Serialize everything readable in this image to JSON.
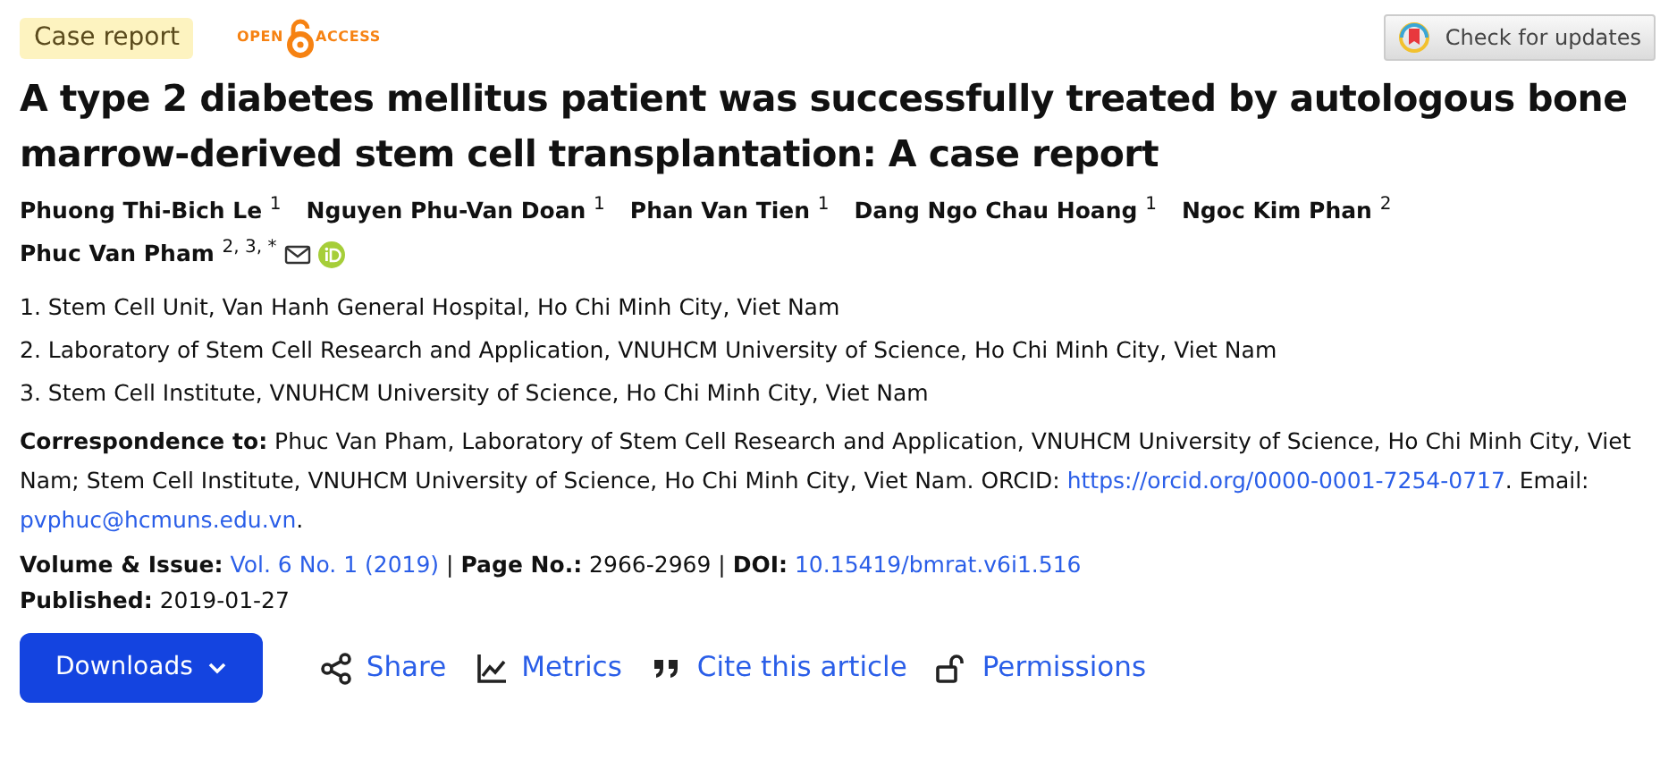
{
  "article_type": "Case report",
  "open_access": {
    "left": "OPEN",
    "right": "ACCESS"
  },
  "check_updates": "Check for updates",
  "title": "A type 2 diabetes mellitus patient was successfully treated by autologous bone marrow-derived stem cell transplantation: A case report",
  "authors": [
    {
      "name": "Phuong Thi-Bich Le $^{1}$",
      "contact": false
    },
    {
      "name": "Nguyen Phu-Van Doan $^{1}$",
      "contact": false
    },
    {
      "name": "Phan Van Tien $^{1}$",
      "contact": false
    },
    {
      "name": "Dang Ngo Chau Hoang $^{1}$",
      "contact": false
    },
    {
      "name": "Ngoc Kim Phan $^{2}$",
      "contact": false
    },
    {
      "name": "Phuc Van Pham $^{2, 3, *}$",
      "contact": true
    }
  ],
  "affiliations": [
    "1. Stem Cell Unit, Van Hanh General Hospital, Ho Chi Minh City, Viet Nam",
    "2. Laboratory of Stem Cell Research and Application, VNUHCM University of Science, Ho Chi Minh City, Viet Nam",
    "3. Stem Cell Institute, VNUHCM University of Science, Ho Chi Minh City, Viet Nam"
  ],
  "correspondence": [
    {
      "kind": "bold",
      "text": "Correspondence to:"
    },
    {
      "kind": "text",
      "text": " Phuc Van Pham, Laboratory of Stem Cell Research and Application, VNUHCM University of Science, Ho Chi Minh City, Viet Nam; Stem Cell Institute, VNUHCM University of Science, Ho Chi Minh City, Viet Nam. ORCID: "
    },
    {
      "kind": "link",
      "text": "https://orcid.org/0000-0001-7254-0717"
    },
    {
      "kind": "text",
      "text": ". Email: "
    },
    {
      "kind": "link",
      "text": "pvphuc@hcmuns.edu.vn"
    },
    {
      "kind": "text",
      "text": "."
    }
  ],
  "meta": [
    {
      "kind": "bold",
      "text": "Volume & Issue:"
    },
    {
      "kind": "link",
      "text": "Vol. 6 No. 1 (2019)"
    },
    {
      "kind": "text",
      "text": " | "
    },
    {
      "kind": "bold",
      "text": "Page No.:"
    },
    {
      "kind": "text",
      "text": " 2966-2969 | "
    },
    {
      "kind": "bold",
      "text": "DOI:"
    },
    {
      "kind": "link",
      "text": "10.15419/bmrat.v6i1.516"
    }
  ],
  "published": {
    "label": "Published:",
    "value": "2019-01-27"
  },
  "downloads": "Downloads",
  "actions": [
    {
      "kind": "share",
      "label": "Share"
    },
    {
      "kind": "metrics",
      "label": "Metrics"
    },
    {
      "kind": "cite",
      "label": "Cite this article"
    },
    {
      "kind": "permissions",
      "label": "Permissions"
    }
  ]
}
